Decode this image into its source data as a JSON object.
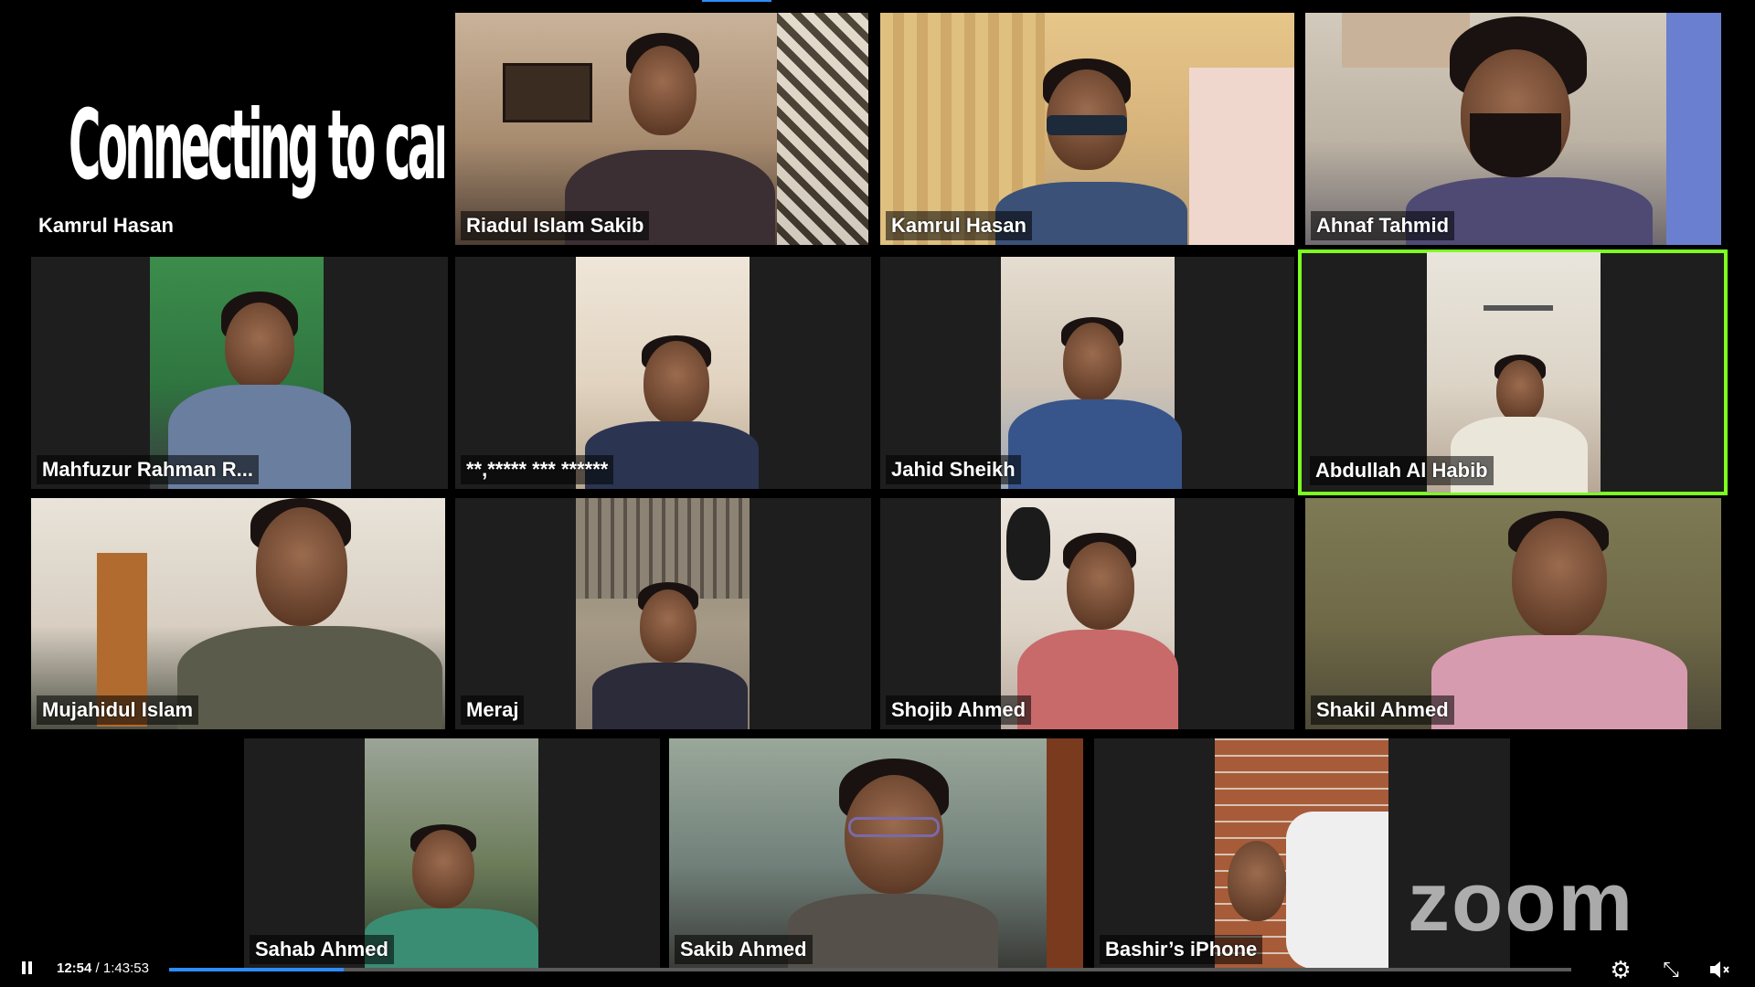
{
  "participants": [
    {
      "name": "Kamrul Hasan",
      "status": "Connecting to camera..."
    },
    {
      "name": "Riadul Islam Sakib"
    },
    {
      "name": "Kamrul Hasan"
    },
    {
      "name": "Ahnaf Tahmid"
    },
    {
      "name": "Mahfuzur Rahman R..."
    },
    {
      "name": "**,***** *** ******"
    },
    {
      "name": "Jahid Sheikh"
    },
    {
      "name": "Abdullah Al Habib",
      "active_speaker": true
    },
    {
      "name": "Mujahidul Islam"
    },
    {
      "name": "Meraj"
    },
    {
      "name": "Shojib Ahmed"
    },
    {
      "name": "Shakil Ahmed"
    },
    {
      "name": "Sahab Ahmed"
    },
    {
      "name": "Sakib Ahmed"
    },
    {
      "name": "Bashir’s iPhone"
    }
  ],
  "branding": {
    "logo_text": "zoom"
  },
  "player": {
    "current_time": "12:54",
    "separator": " / ",
    "duration": "1:43:53",
    "progress_fraction": 0.1242,
    "play_state": "pause-icon",
    "icons": [
      "gear-icon",
      "exit-fullscreen-icon",
      "volume-icon"
    ]
  },
  "colors": {
    "active_speaker_border": "#7dff1f",
    "progress": "#2d8cff",
    "tile_background": "#1e1e1e"
  }
}
